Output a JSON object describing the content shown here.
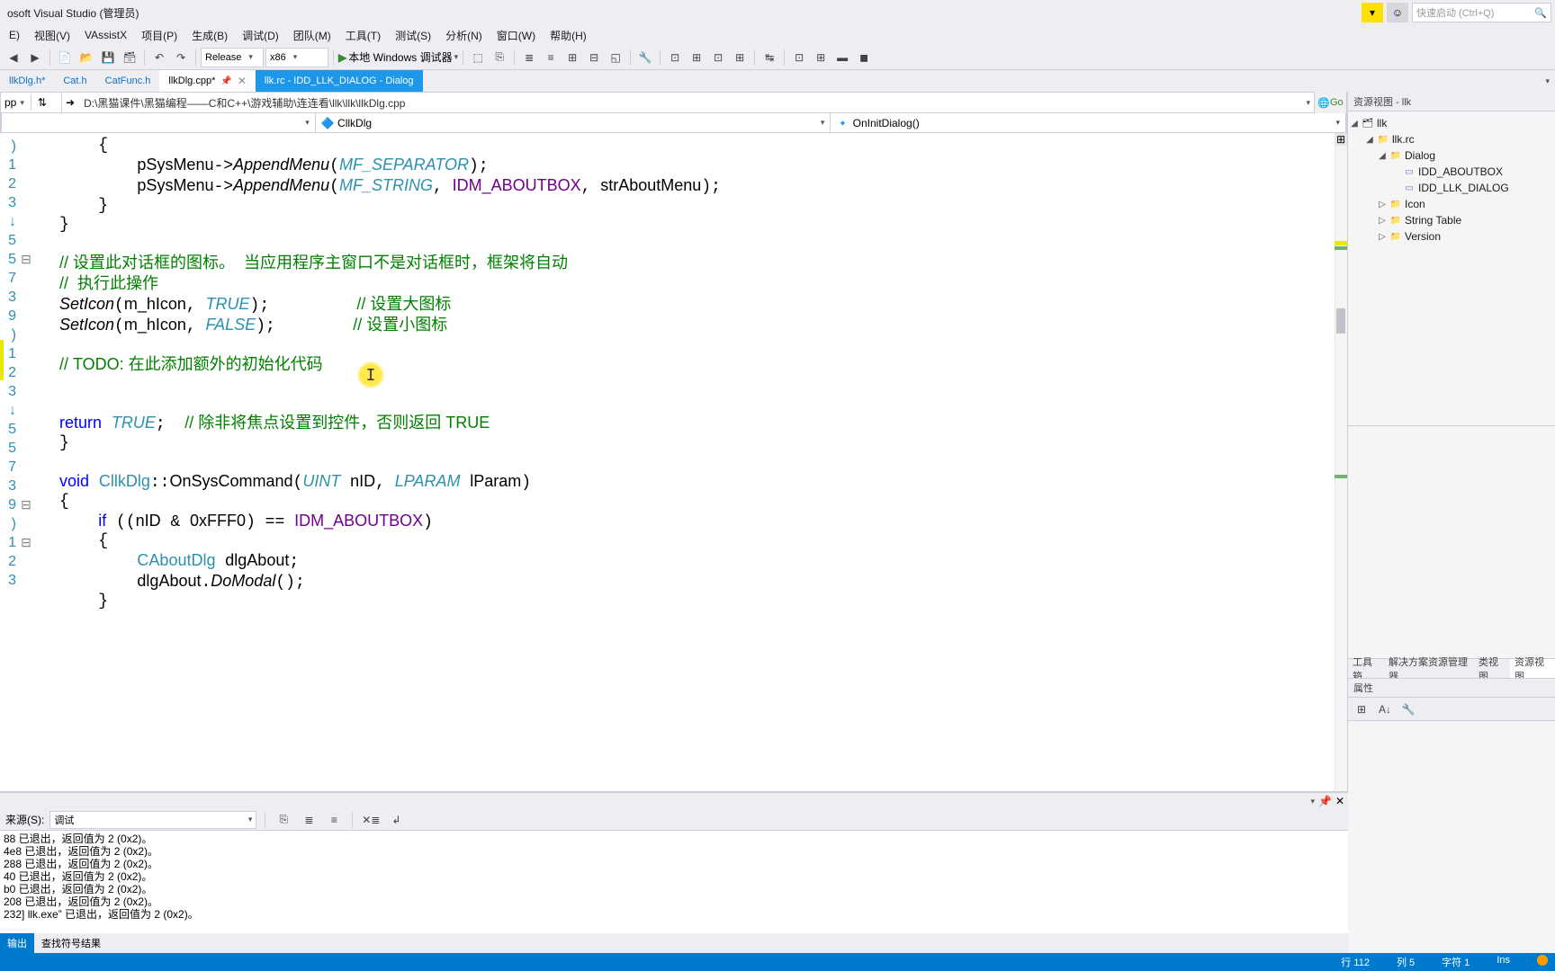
{
  "title": "osoft Visual Studio (管理员)",
  "quick_launch_placeholder": "快速启动 (Ctrl+Q)",
  "menus": [
    "E)",
    "视图(V)",
    "VAssistX",
    "项目(P)",
    "生成(B)",
    "调试(D)",
    "团队(M)",
    "工具(T)",
    "测试(S)",
    "分析(N)",
    "窗口(W)",
    "帮助(H)"
  ],
  "toolbar": {
    "config": "Release",
    "platform": "x86",
    "run_label": "本地 Windows 调试器"
  },
  "tabs": [
    {
      "label": "llkDlg.h*",
      "active": false
    },
    {
      "label": "Cat.h",
      "active": false
    },
    {
      "label": "CatFunc.h",
      "active": false
    },
    {
      "label": "llkDlg.cpp*",
      "active": true,
      "pinned": true,
      "closeable": true
    },
    {
      "label": "llk.rc - IDD_LLK_DIALOG - Dialog",
      "active": false
    }
  ],
  "filepath_left": "pp",
  "filepath": "D:\\黑猫课件\\黑猫编程——C和C++\\游戏辅助\\连连看\\llk\\llk\\llkDlg.cpp",
  "go_label": "Go",
  "nav": {
    "empty": "",
    "class": "CllkDlg",
    "method": "OnInitDialog()"
  },
  "resource_view": {
    "title": "资源视图 - llk",
    "root": "llk",
    "rc": "llk.rc",
    "dialog_folder": "Dialog",
    "dialogs": [
      "IDD_ABOUTBOX",
      "IDD_LLK_DIALOG"
    ],
    "other_folders": [
      "Icon",
      "String Table",
      "Version"
    ]
  },
  "right_tabs": [
    "工具箱",
    "解决方案资源管理器",
    "类视图",
    "资源视图"
  ],
  "right_tabs_active_idx": 3,
  "properties_title": "属性",
  "output": {
    "source_label": "来源(S):",
    "source_value": "调试",
    "lines": [
      "88 已退出，返回值为 2 (0x2)。",
      "4e8 已退出，返回值为 2 (0x2)。",
      "288 已退出，返回值为 2 (0x2)。",
      "40 已退出，返回值为 2 (0x2)。",
      "b0 已退出，返回值为 2 (0x2)。",
      "208 已退出，返回值为 2 (0x2)。",
      "232] llk.exe” 已退出，返回值为 2 (0x2)。"
    ],
    "tabs": [
      "输出",
      "查找符号结果"
    ],
    "active_tab_idx": 0
  },
  "status": {
    "line": "行 112",
    "col": "列 5",
    "char": "字符 1",
    "ins": "Ins"
  },
  "code_strings": {
    "append_sep": "AppendMenu",
    "append_str": "AppendMenu",
    "mf_sep": "MF_SEPARATOR",
    "mf_str": "MF_STRING",
    "idm_about": "IDM_ABOUTBOX",
    "str_about": "strAboutMenu",
    "comment_seticon1": "// 设置此对话框的图标。  当应用程序主窗口不是对话框时，框架将自动",
    "comment_seticon2": "//  执行此操作",
    "seticon": "SetIcon",
    "m_hicon": "m_hIcon",
    "true": "TRUE",
    "false": "FALSE",
    "comment_big": "// 设置大图标",
    "comment_small": "// 设置小图标",
    "todo": "// TODO: 在此添加额外的初始化代码",
    "return": "return",
    "comment_return": "// 除非将焦点设置到控件，否则返回 TRUE",
    "void": "void",
    "cllkdlg": "CllkDlg",
    "onsyscmd": "OnSysCommand",
    "uint": "UINT",
    "nid": "nID",
    "lparam": "LPARAM",
    "lparam_v": "lParam",
    "if": "if",
    "mask": "0xFFF0",
    "caboutdlg": "CAboutDlg",
    "dlgabout": "dlgAbout",
    "domodal": "DoModal",
    "psysmenu": "pSysMenu"
  }
}
